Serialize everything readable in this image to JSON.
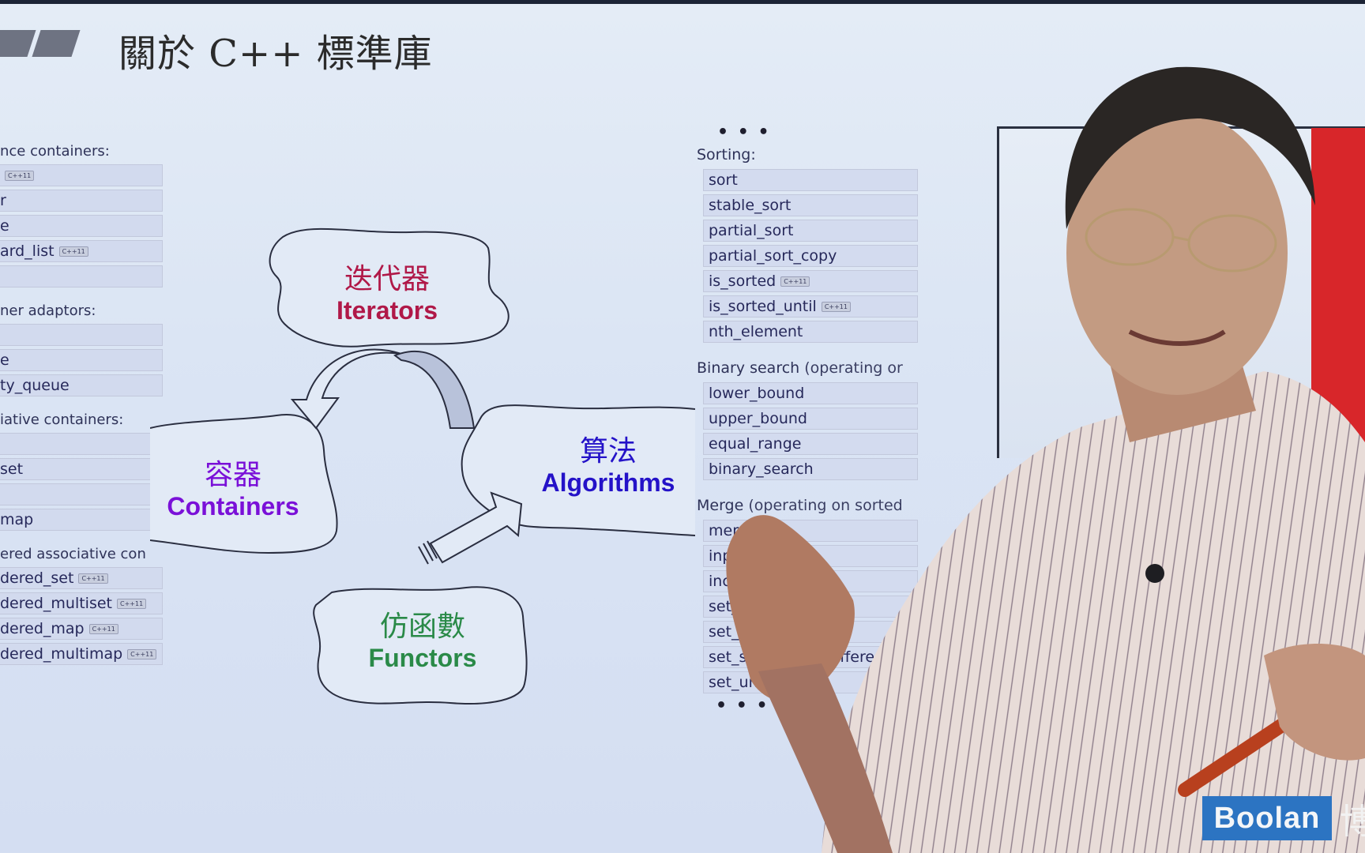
{
  "slide": {
    "title": "關於 C++ 標準庫"
  },
  "left_column": {
    "sections": [
      {
        "label": "nce containers:",
        "items": [
          {
            "text": "",
            "badge": "C++11"
          },
          {
            "text": "r",
            "badge": ""
          },
          {
            "text": "e",
            "badge": ""
          },
          {
            "text": "ard_list",
            "badge": "C++11"
          },
          {
            "text": "",
            "badge": ""
          }
        ]
      },
      {
        "label": "ner adaptors:",
        "items": [
          {
            "text": "",
            "badge": ""
          },
          {
            "text": "e",
            "badge": ""
          },
          {
            "text": "ty_queue",
            "badge": ""
          }
        ]
      },
      {
        "label": "iative containers:",
        "items": [
          {
            "text": "",
            "badge": ""
          },
          {
            "text": "set",
            "badge": ""
          },
          {
            "text": "",
            "badge": ""
          },
          {
            "text": "map",
            "badge": ""
          }
        ]
      },
      {
        "label": "ered associative con",
        "items": [
          {
            "text": "dered_set",
            "badge": "C++11"
          },
          {
            "text": "dered_multiset",
            "badge": "C++11"
          },
          {
            "text": "dered_map",
            "badge": "C++11"
          },
          {
            "text": "dered_multimap",
            "badge": "C++11"
          }
        ]
      }
    ]
  },
  "right_column": {
    "top_ellipsis": "• • •",
    "bottom_ellipsis": "• • •",
    "sections": [
      {
        "label": "Sorting:",
        "label_note": "",
        "items": [
          {
            "text": "sort",
            "badge": ""
          },
          {
            "text": "stable_sort",
            "badge": ""
          },
          {
            "text": "partial_sort",
            "badge": ""
          },
          {
            "text": "partial_sort_copy",
            "badge": ""
          },
          {
            "text": "is_sorted",
            "badge": "C++11"
          },
          {
            "text": "is_sorted_until",
            "badge": "C++11"
          },
          {
            "text": "nth_element",
            "badge": ""
          }
        ]
      },
      {
        "label": "Binary search",
        "label_note": " (operating or",
        "items": [
          {
            "text": "lower_bound",
            "badge": ""
          },
          {
            "text": "upper_bound",
            "badge": ""
          },
          {
            "text": "equal_range",
            "badge": ""
          },
          {
            "text": "binary_search",
            "badge": ""
          }
        ]
      },
      {
        "label": "Merge",
        "label_note": " (operating on sorted",
        "items": [
          {
            "text": "merge",
            "badge": ""
          },
          {
            "text": "inplace_merge",
            "badge": ""
          },
          {
            "text": "includes",
            "badge": ""
          },
          {
            "text": "set_difference",
            "badge": ""
          },
          {
            "text": "set_intersection",
            "badge": ""
          },
          {
            "text": "set_symmetric_difference",
            "badge": ""
          },
          {
            "text": "set_union",
            "badge": ""
          }
        ]
      }
    ]
  },
  "diagram": {
    "iterators": {
      "zh": "迭代器",
      "en": "Iterators",
      "color": "#b01848"
    },
    "containers": {
      "zh": "容器",
      "en": "Containers",
      "color": "#7a10d8"
    },
    "algorithms": {
      "zh": "算法",
      "en": "Algorithms",
      "color": "#2412c8"
    },
    "functors": {
      "zh": "仿函數",
      "en": "Functors",
      "color": "#2a8a48"
    }
  },
  "watermark": {
    "logo_text": "Boolan",
    "logo_cjk": "博",
    "logo_color": "#2c74c2"
  }
}
